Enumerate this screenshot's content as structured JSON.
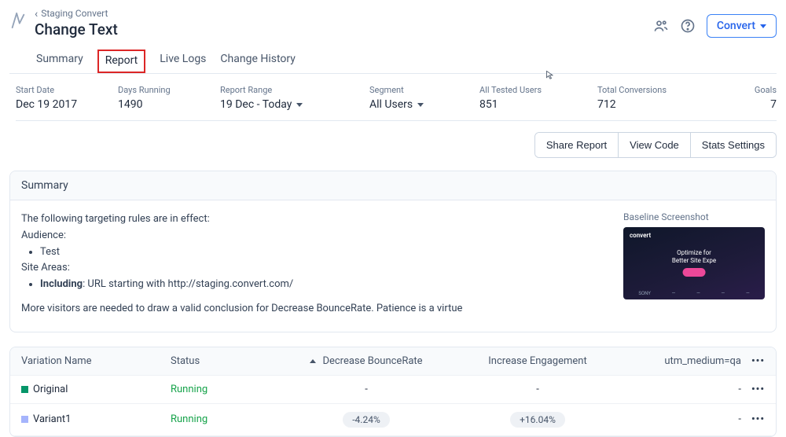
{
  "header": {
    "breadcrumb": "Staging Convert",
    "title": "Change Text",
    "convert_btn": "Convert"
  },
  "tabs": {
    "summary": "Summary",
    "report": "Report",
    "live_logs": "Live Logs",
    "change_history": "Change History"
  },
  "stats": {
    "start_date_label": "Start Date",
    "start_date_value": "Dec 19 2017",
    "days_running_label": "Days Running",
    "days_running_value": "1490",
    "report_range_label": "Report Range",
    "report_range_value": "19 Dec - Today",
    "segment_label": "Segment",
    "segment_value": "All Users",
    "tested_users_label": "All Tested Users",
    "tested_users_value": "851",
    "total_conversions_label": "Total Conversions",
    "total_conversions_value": "712",
    "goals_label": "Goals",
    "goals_value": "7"
  },
  "actions": {
    "share": "Share Report",
    "view_code": "View Code",
    "stats_settings": "Stats Settings"
  },
  "summary_card": {
    "title": "Summary",
    "intro": "The following targeting rules are in effect:",
    "audience_label": "Audience:",
    "audience_item": "Test",
    "site_areas_label": "Site Areas:",
    "including_prefix": "Including",
    "including_rest": ": URL starting with http://staging.convert.com/",
    "conclusion": "More visitors are needed to draw a valid conclusion for Decrease BounceRate. Patience is a virtue",
    "screenshot_label": "Baseline Screenshot",
    "thumb_logo": "convert",
    "thumb_line1": "Optimize for",
    "thumb_line2": "Better Site Expe",
    "thumb_brand_sony": "SONY"
  },
  "table": {
    "headers": {
      "variation": "Variation Name",
      "status": "Status",
      "bounce": "Decrease BounceRate",
      "engagement": "Increase Engagement",
      "utm": "utm_medium=qa"
    },
    "rows": [
      {
        "name": "Original",
        "status": "Running",
        "bounce": "-",
        "engagement": "-",
        "utm": "-"
      },
      {
        "name": "Variant1",
        "status": "Running",
        "bounce": "-4.24%",
        "engagement": "+16.04%",
        "utm": "-"
      }
    ]
  }
}
